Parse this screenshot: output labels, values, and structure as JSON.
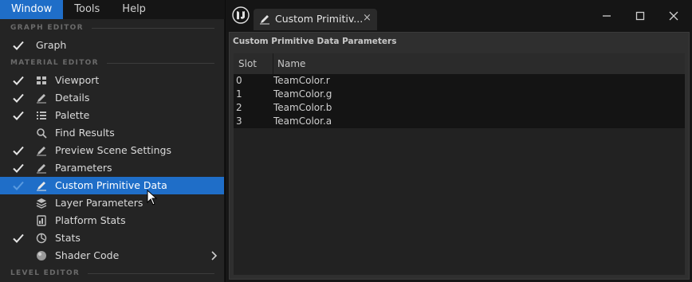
{
  "menubar": {
    "items": [
      {
        "label": "Window",
        "active": true
      },
      {
        "label": "Tools",
        "active": false
      },
      {
        "label": "Help",
        "active": false
      }
    ]
  },
  "menu": {
    "sections": {
      "graph_editor": "GRAPH EDITOR",
      "material_editor": "MATERIAL EDITOR",
      "level_editor": "LEVEL EDITOR"
    },
    "items": [
      {
        "label": "Graph",
        "checked": true,
        "icon": "none"
      },
      {
        "label": "Viewport",
        "checked": true,
        "icon": "viewport-icon"
      },
      {
        "label": "Details",
        "checked": true,
        "icon": "pencil-icon"
      },
      {
        "label": "Palette",
        "checked": true,
        "icon": "list-icon"
      },
      {
        "label": "Find Results",
        "checked": false,
        "icon": "search-icon"
      },
      {
        "label": "Preview Scene Settings",
        "checked": true,
        "icon": "pencil-icon"
      },
      {
        "label": "Parameters",
        "checked": true,
        "icon": "pencil-icon"
      },
      {
        "label": "Custom Primitive Data",
        "checked": true,
        "icon": "pencil-icon",
        "highlighted": true
      },
      {
        "label": "Layer Parameters",
        "checked": false,
        "icon": "layers-icon"
      },
      {
        "label": "Platform Stats",
        "checked": false,
        "icon": "platform-icon"
      },
      {
        "label": "Stats",
        "checked": true,
        "icon": "stats-icon"
      },
      {
        "label": "Shader Code",
        "checked": false,
        "icon": "sphere-icon",
        "submenu": true
      }
    ]
  },
  "window": {
    "tab_label": "Custom Primitiv...",
    "tab_close": "×",
    "panel_title": "Custom Primitive Data Parameters",
    "table": {
      "columns": [
        "Slot",
        "Name"
      ],
      "rows": [
        {
          "slot": "0",
          "name": "TeamColor.r"
        },
        {
          "slot": "1",
          "name": "TeamColor.g"
        },
        {
          "slot": "2",
          "name": "TeamColor.b"
        },
        {
          "slot": "3",
          "name": "TeamColor.a"
        }
      ]
    }
  },
  "colors": {
    "highlight": "#1f6ec8",
    "menu_bg": "#242424",
    "table_row_bg": "#141414"
  }
}
